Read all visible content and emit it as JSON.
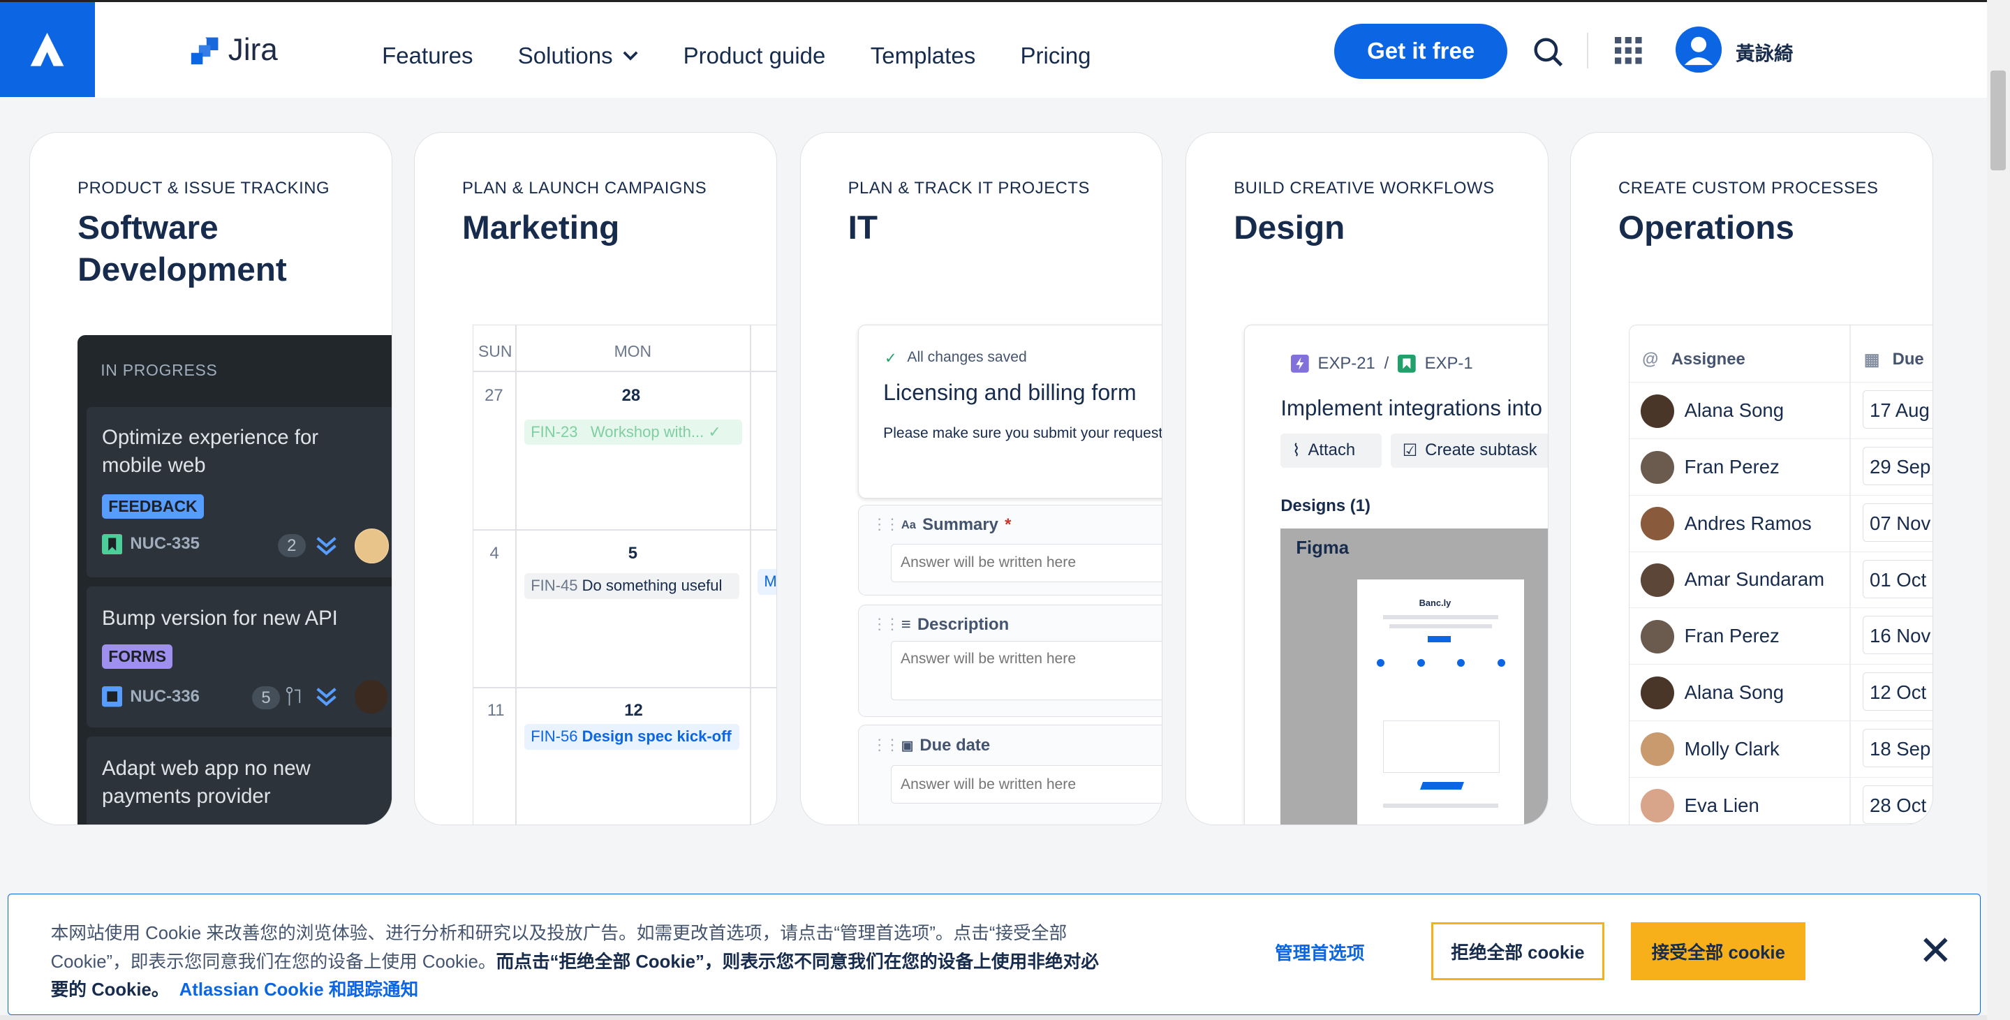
{
  "header": {
    "brand": "Jira",
    "nav": [
      "Features",
      "Solutions",
      "Product guide",
      "Templates",
      "Pricing"
    ],
    "cta": "Get it free",
    "user_name": "黃詠綺"
  },
  "cards": {
    "software": {
      "eyebrow": "PRODUCT & ISSUE TRACKING",
      "title": "Software Development",
      "column_label": "IN PROGRESS",
      "items": [
        {
          "title": "Optimize experience for mobile web",
          "tag": "FEEDBACK",
          "key": "NUC-335",
          "count": "2"
        },
        {
          "title": "Bump version for new API",
          "tag": "FORMS",
          "key": "NUC-336",
          "count": "5"
        },
        {
          "title": "Adapt web app no new payments provider"
        }
      ]
    },
    "marketing": {
      "eyebrow": "PLAN & LAUNCH CAMPAIGNS",
      "title": "Marketing",
      "days": [
        "SUN",
        "MON"
      ],
      "weeks": [
        {
          "sun": "27",
          "mon": "28"
        },
        {
          "sun": "4",
          "mon": "5"
        },
        {
          "sun": "11",
          "mon": "12"
        }
      ],
      "events": [
        {
          "key": "FIN-23",
          "text": "Workshop with..."
        },
        {
          "key": "FIN-45",
          "text": "Do something useful"
        },
        {
          "key": "FIN-56",
          "text": "Design spec kick-off"
        }
      ],
      "overflow_letter": "M"
    },
    "it": {
      "eyebrow": "PLAN & TRACK IT PROJECTS",
      "title": "IT",
      "saved": "All changes saved",
      "form_title": "Licensing and billing form",
      "form_desc": "Please make sure you submit your request to help us prioritize your asks within our road",
      "fields": [
        {
          "label": "Summary",
          "placeholder": "Answer will be written here"
        },
        {
          "label": "Description",
          "placeholder": "Answer will be written here"
        },
        {
          "label": "Due date",
          "placeholder": "Answer will be written here"
        }
      ]
    },
    "design": {
      "eyebrow": "BUILD CREATIVE WORKFLOWS",
      "title": "Design",
      "crumb1": "EXP-21",
      "crumb_sep": "/",
      "crumb2": "EXP-1",
      "issue_title": "Implement integrations into",
      "attach": "Attach",
      "subtask": "Create subtask",
      "designs_label": "Designs (1)",
      "figma_label": "Figma",
      "mock_brand": "Banc.ly"
    },
    "operations": {
      "eyebrow": "CREATE CUSTOM PROCESSES",
      "title": "Operations",
      "col_assignee": "Assignee",
      "col_due": "Due",
      "rows": [
        {
          "name": "Alana Song",
          "due": "17 Aug"
        },
        {
          "name": "Fran Perez",
          "due": "29 Sep"
        },
        {
          "name": "Andres Ramos",
          "due": "07 Nov"
        },
        {
          "name": "Amar Sundaram",
          "due": "01 Oct"
        },
        {
          "name": "Fran Perez",
          "due": "16 Nov"
        },
        {
          "name": "Alana Song",
          "due": "12 Oct"
        },
        {
          "name": "Molly Clark",
          "due": "18 Sep"
        },
        {
          "name": "Eva Lien",
          "due": "28 Oct"
        }
      ]
    }
  },
  "cookie": {
    "text_1": "本网站使用 Cookie 来改善您的浏览体验、进行分析和研究以及投放广告。如需更改首选项，请点击“管理首选项”。点击“接受全部 Cookie”，即表示您同意我们在您的设备上使用 Cookie。",
    "text_bold": "而点击“拒绝全部 Cookie”，则表示您不同意我们在您的设备上使用非绝对必要的 Cookie。",
    "link": "Atlassian Cookie 和跟踪通知",
    "manage": "管理首选项",
    "reject": "拒绝全部 cookie",
    "accept": "接受全部 cookie",
    "close": "✕"
  },
  "colors": {
    "brand_blue": "#0c66e4",
    "cookie_yellow": "#f8b01a",
    "feedback_lozenge": "#579dff",
    "forms_lozenge": "#9f8fef"
  }
}
